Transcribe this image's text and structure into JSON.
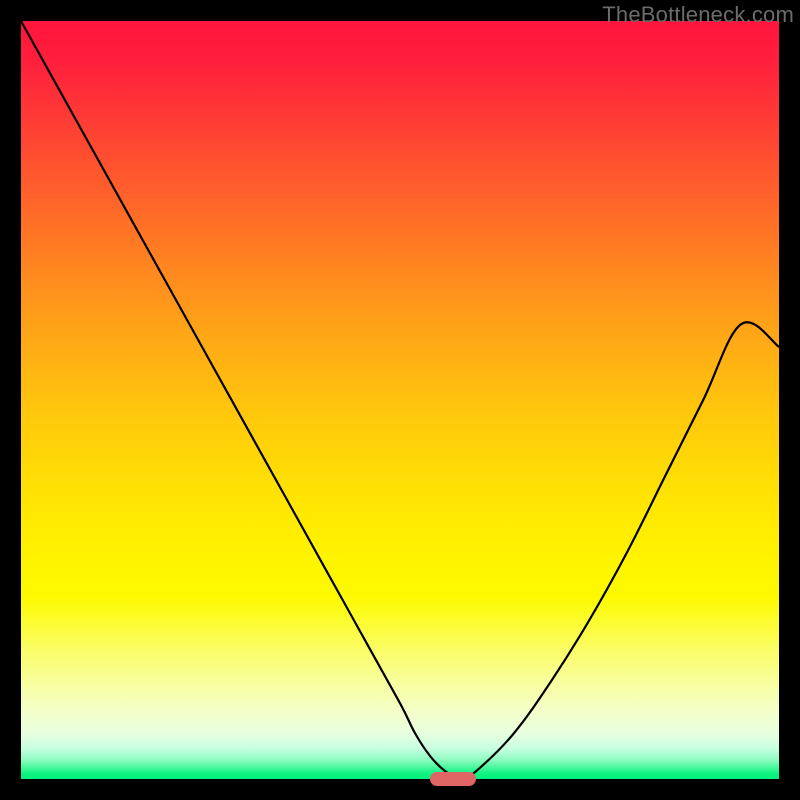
{
  "watermark": "TheBottleneck.com",
  "colors": {
    "frame_bg": "#000000",
    "curve_stroke": "#000000",
    "marker_fill": "#e06666"
  },
  "chart_data": {
    "type": "line",
    "title": "",
    "xlabel": "",
    "ylabel": "",
    "xlim": [
      0,
      100
    ],
    "ylim": [
      0,
      100
    ],
    "grid": false,
    "legend": false,
    "series": [
      {
        "name": "bottleneck-curve",
        "x": [
          0,
          5,
          10,
          15,
          20,
          25,
          30,
          35,
          40,
          45,
          50,
          52,
          54,
          56,
          58,
          60,
          65,
          70,
          75,
          80,
          85,
          90,
          95,
          100
        ],
        "y": [
          100,
          91,
          82,
          73,
          64,
          55,
          46,
          37,
          28,
          19,
          10,
          6,
          3,
          1,
          0,
          1,
          6,
          13,
          21,
          30,
          40,
          50,
          60,
          57
        ]
      }
    ],
    "marker": {
      "x": 57,
      "y": 0,
      "width_pct": 6
    }
  }
}
